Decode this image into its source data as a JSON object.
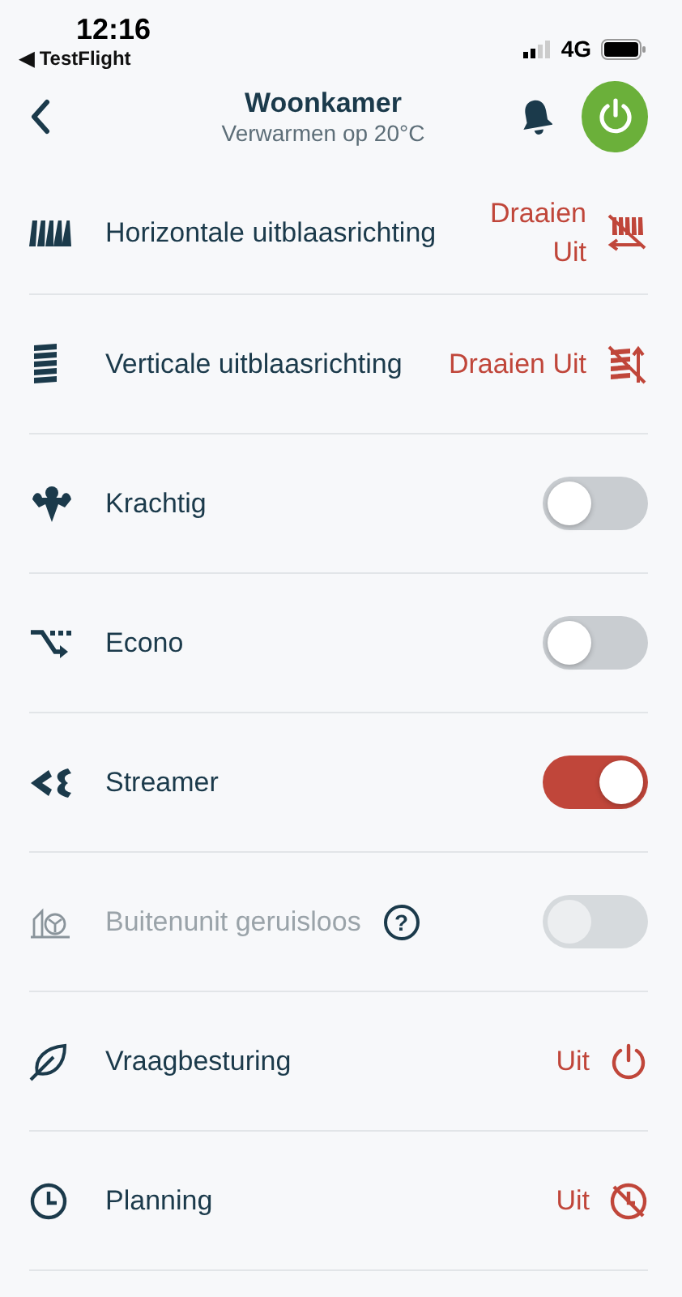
{
  "status_bar": {
    "time": "12:16",
    "back_app": "◀ TestFlight",
    "network": "4G"
  },
  "header": {
    "title": "Woonkamer",
    "subtitle": "Verwarmen op 20°C",
    "power_on": true
  },
  "settings": [
    {
      "kind": "value",
      "label": "Horizontale uitblaasrichting",
      "value": "Draaien Uit"
    },
    {
      "kind": "value",
      "label": "Verticale uitblaasrichting",
      "value": "Draaien Uit"
    },
    {
      "kind": "toggle",
      "label": "Krachtig",
      "on": false,
      "disabled": false
    },
    {
      "kind": "toggle",
      "label": "Econo",
      "on": false,
      "disabled": false
    },
    {
      "kind": "toggle",
      "label": "Streamer",
      "on": true,
      "disabled": false
    },
    {
      "kind": "toggle",
      "label": "Buitenunit geruisloos",
      "on": false,
      "disabled": true,
      "help_label": "?"
    },
    {
      "kind": "value",
      "label": "Vraagbesturing",
      "value": "Uit"
    },
    {
      "kind": "value",
      "label": "Planning",
      "value": "Uit"
    }
  ]
}
